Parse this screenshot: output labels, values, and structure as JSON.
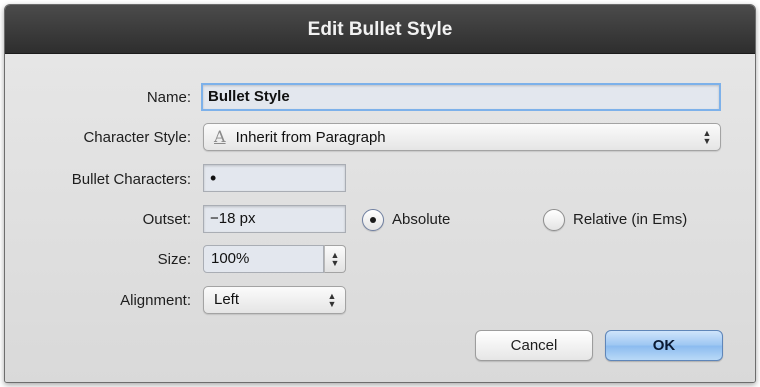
{
  "dialog": {
    "title": "Edit Bullet Style"
  },
  "form": {
    "name": {
      "label": "Name:",
      "value": "Bullet Style"
    },
    "character_style": {
      "label": "Character Style:",
      "value": "Inherit from Paragraph",
      "icon": "character-style-icon",
      "icon_glyph": "A"
    },
    "bullet_characters": {
      "label": "Bullet Characters:",
      "value": "•"
    },
    "outset": {
      "label": "Outset:",
      "value": "−18 px",
      "options": [
        {
          "label": "Absolute",
          "selected": true
        },
        {
          "label": "Relative (in Ems)",
          "selected": false
        }
      ]
    },
    "size": {
      "label": "Size:",
      "value": "100%"
    },
    "alignment": {
      "label": "Alignment:",
      "value": "Left"
    }
  },
  "buttons": {
    "cancel": "Cancel",
    "ok": "OK"
  },
  "colors": {
    "titlebar": "#3a3a3a",
    "focus_ring": "#7db1ea",
    "ok_button": "#9cc6f2"
  }
}
